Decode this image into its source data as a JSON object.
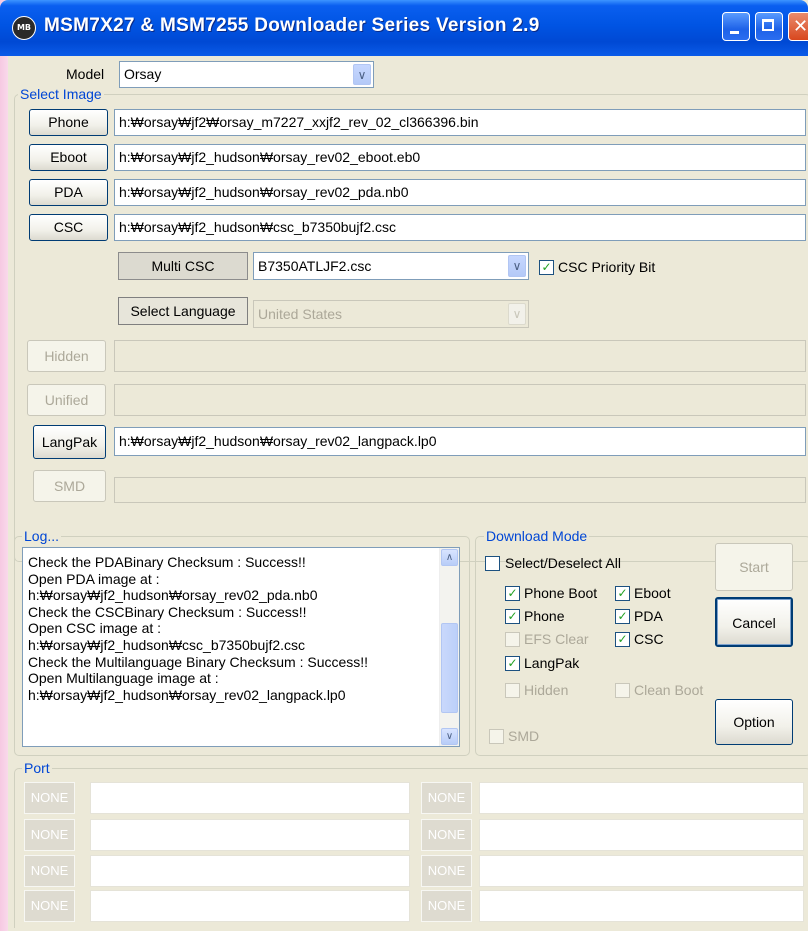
{
  "window": {
    "title": "MSM7X27 & MSM7255 Downloader Series Version 2.9",
    "app_icon_text": "MB"
  },
  "model": {
    "label": "Model",
    "value": "Orsay"
  },
  "select_image": {
    "group_label": "Select Image",
    "rows": [
      {
        "button": "Phone",
        "path": "h:₩orsay₩jf2₩orsay_m7227_xxjf2_rev_02_cl366396.bin"
      },
      {
        "button": "Eboot",
        "path": "h:₩orsay₩jf2_hudson₩orsay_rev02_eboot.eb0"
      },
      {
        "button": "PDA",
        "path": "h:₩orsay₩jf2_hudson₩orsay_rev02_pda.nb0"
      },
      {
        "button": "CSC",
        "path": "h:₩orsay₩jf2_hudson₩csc_b7350bujf2.csc"
      }
    ],
    "multi_csc_label": "Multi CSC",
    "multi_csc_value": "B7350ATLJF2.csc",
    "csc_priority_label": "CSC Priority Bit",
    "csc_priority_checked": true,
    "select_language_label": "Select Language",
    "language_value": "United States",
    "hidden_button": "Hidden",
    "unified_button": "Unified",
    "langpak_button": "LangPak",
    "langpak_path": "h:₩orsay₩jf2_hudson₩orsay_rev02_langpack.lp0",
    "smd_button": "SMD"
  },
  "log": {
    "group_label": "Log...",
    "lines": [
      "Check the PDABinary Checksum : Success!!",
      "Open PDA image at :",
      "h:₩orsay₩jf2_hudson₩orsay_rev02_pda.nb0",
      "Check the CSCBinary Checksum : Success!!",
      "Open CSC image at :",
      "h:₩orsay₩jf2_hudson₩csc_b7350bujf2.csc",
      "Check the Multilanguage Binary Checksum : Success!!",
      "Open Multilanguage  image at :",
      "h:₩orsay₩jf2_hudson₩orsay_rev02_langpack.lp0"
    ]
  },
  "download_mode": {
    "group_label": "Download Mode",
    "select_all": "Select/Deselect All",
    "phone_boot": "Phone Boot",
    "eboot": "Eboot",
    "phone": "Phone",
    "pda": "PDA",
    "efs_clear": "EFS Clear",
    "csc": "CSC",
    "langpak": "LangPak",
    "hidden": "Hidden",
    "clean_boot": "Clean Boot",
    "smd": "SMD",
    "start_button": "Start",
    "cancel_button": "Cancel",
    "option_button": "Option"
  },
  "port": {
    "group_label": "Port",
    "none_label": "NONE"
  },
  "check_mark": "✓",
  "arrow_down": "∨",
  "arrow_up": "∧"
}
